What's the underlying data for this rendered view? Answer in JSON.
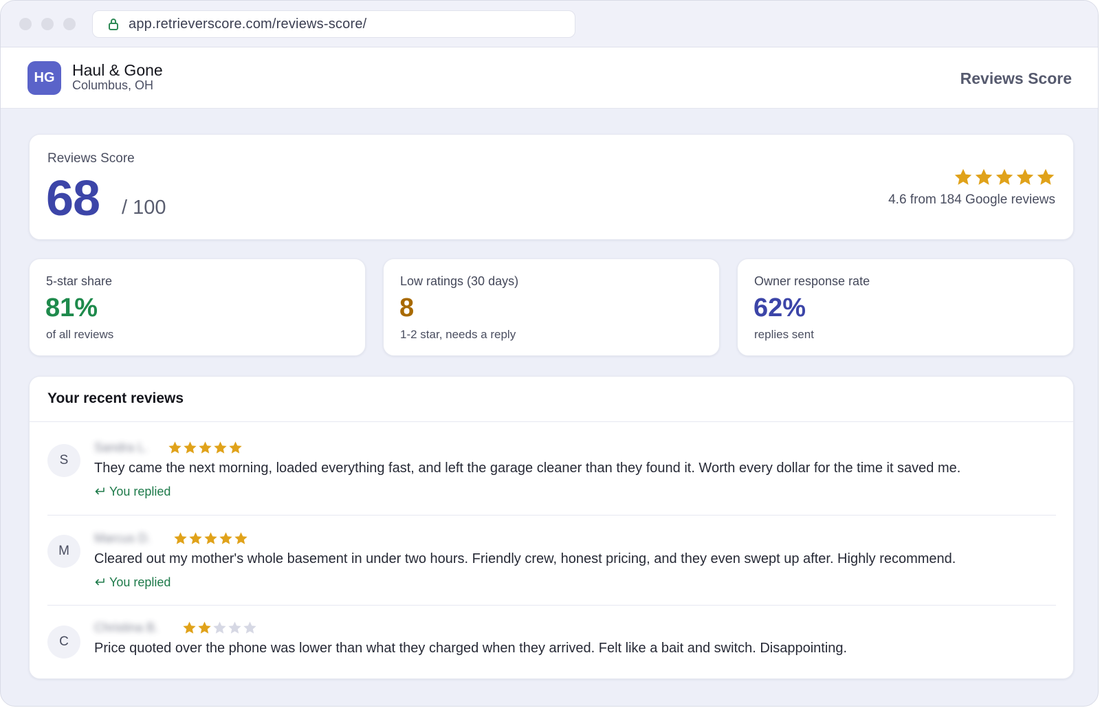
{
  "browser": {
    "url": "app.retrieverscore.com/reviews-score/"
  },
  "header": {
    "logo_initials": "HG",
    "business_name": "Haul & Gone",
    "location": "Columbus, OH",
    "page_title": "Reviews Score"
  },
  "score": {
    "label": "Reviews Score",
    "value": "68",
    "denominator": "/ 100",
    "rating_stars": 5,
    "rating_text": "4.6 from 184 Google reviews"
  },
  "stats": [
    {
      "label": "5-star share",
      "value": "81%",
      "sub": "of all reviews",
      "color": "#1e8a4c"
    },
    {
      "label": "Low ratings (30 days)",
      "value": "8",
      "sub": "1-2 star, needs a reply",
      "color": "#a86a00"
    },
    {
      "label": "Owner response rate",
      "value": "62%",
      "sub": "replies sent",
      "color": "#3c45a8"
    }
  ],
  "reviews": {
    "title": "Your recent reviews",
    "items": [
      {
        "initial": "S",
        "name": "Sandra L.",
        "rating": 5,
        "text": "They came the next morning, loaded everything fast, and left the garage cleaner than they found it. Worth every dollar for the time it saved me.",
        "reply_status": "You replied"
      },
      {
        "initial": "M",
        "name": "Marcus D.",
        "rating": 5,
        "text": "Cleared out my mother's whole basement in under two hours. Friendly crew, honest pricing, and they even swept up after. Highly recommend.",
        "reply_status": "You replied"
      },
      {
        "initial": "C",
        "name": "Christina B.",
        "rating": 2,
        "text": "Price quoted over the phone was lower than what they charged when they arrived. Felt like a bait and switch. Disappointing.",
        "reply_status": ""
      }
    ]
  },
  "colors": {
    "accent": "#3c45a8",
    "star_filled": "#e0a21a",
    "star_empty": "#d6d8e4",
    "replied": "#1e7a4a"
  }
}
